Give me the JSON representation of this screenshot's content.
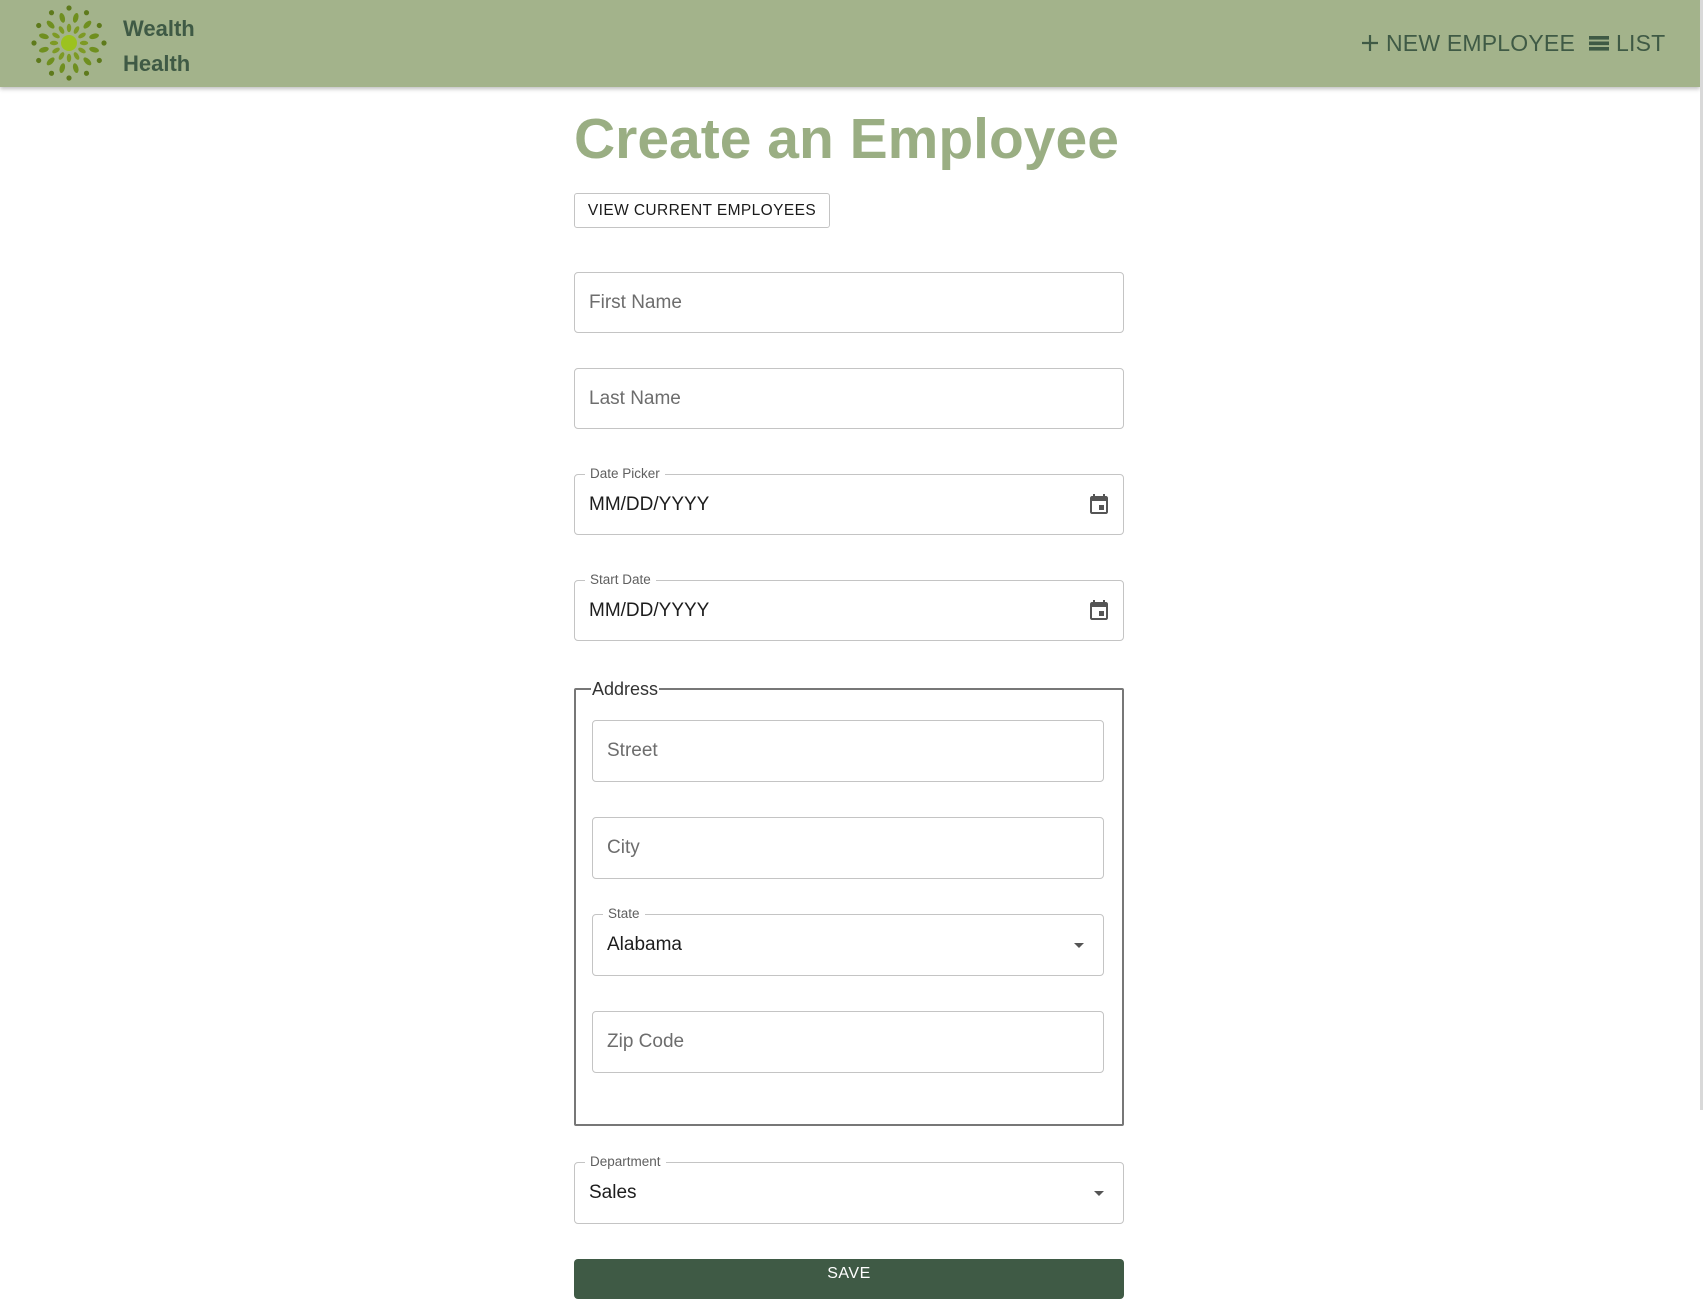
{
  "brand": {
    "line1": "Wealth",
    "line2": "Health"
  },
  "nav": {
    "new_employee": "NEW EMPLOYEE",
    "list": "LIST"
  },
  "page": {
    "title": "Create an Employee",
    "view_button": "VIEW CURRENT EMPLOYEES"
  },
  "form": {
    "first_name": {
      "placeholder": "First Name",
      "value": ""
    },
    "last_name": {
      "placeholder": "Last Name",
      "value": ""
    },
    "date_of_birth": {
      "label": "Date Picker",
      "value": "MM/DD/YYYY",
      "icon": "calendar-icon"
    },
    "start_date": {
      "label": "Start Date",
      "value": "MM/DD/YYYY",
      "icon": "calendar-icon"
    },
    "address": {
      "legend": "Address",
      "street": {
        "placeholder": "Street"
      },
      "city": {
        "placeholder": "City"
      },
      "state": {
        "label": "State",
        "value": "Alabama"
      },
      "zip": {
        "placeholder": "Zip Code"
      }
    },
    "department": {
      "label": "Department",
      "value": "Sales"
    },
    "save": "SAVE"
  },
  "colors": {
    "header_bg": "#a3b38b",
    "brand_text": "#3f5a45",
    "title": "#9aae83",
    "save_bg": "#3f5a45",
    "logo": "#6f8f1f"
  }
}
